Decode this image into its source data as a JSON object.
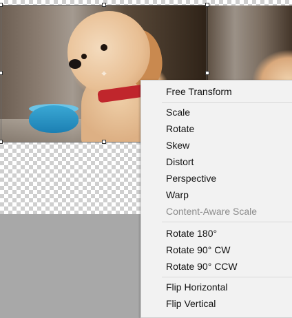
{
  "context_menu": {
    "items": [
      {
        "label": "Free Transform",
        "enabled": true
      },
      {
        "label": "Scale",
        "enabled": true
      },
      {
        "label": "Rotate",
        "enabled": true
      },
      {
        "label": "Skew",
        "enabled": true
      },
      {
        "label": "Distort",
        "enabled": true
      },
      {
        "label": "Perspective",
        "enabled": true
      },
      {
        "label": "Warp",
        "enabled": true
      },
      {
        "label": "Content-Aware Scale",
        "enabled": false
      },
      {
        "label": "Rotate 180°",
        "enabled": true
      },
      {
        "label": "Rotate 90° CW",
        "enabled": true
      },
      {
        "label": "Rotate 90° CCW",
        "enabled": true
      },
      {
        "label": "Flip Horizontal",
        "enabled": true
      },
      {
        "label": "Flip Vertical",
        "enabled": true
      }
    ]
  },
  "canvas": {
    "layer_subject": "puppy photo",
    "transparent_background": true
  },
  "colors": {
    "menu_bg": "#f2f2f2",
    "workspace_bg": "#a8a8a8",
    "disabled_text": "#8a8a8a"
  }
}
